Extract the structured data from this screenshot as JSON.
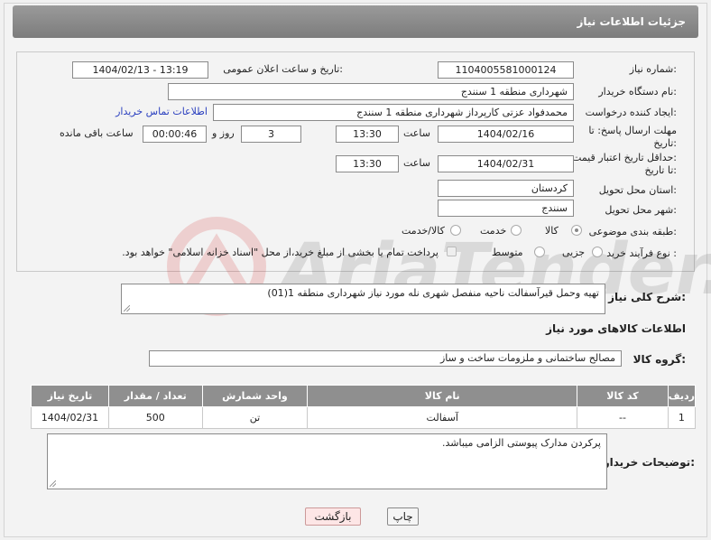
{
  "page": {
    "title": "جزئیات اطلاعات نیاز"
  },
  "form": {
    "need_number": {
      "label": "شماره نیاز:",
      "value": "1104005581000124"
    },
    "announce": {
      "label": "تاریخ و ساعت اعلان عمومی:",
      "value": "1404/02/13 - 13:19"
    },
    "buyer_org": {
      "label": "نام دستگاه خریدار:",
      "value": "شهرداری منطقه 1 سنندج"
    },
    "requester": {
      "label": "ایجاد کننده درخواست:",
      "value": "محمدفواد عزتی کارپرداز شهرداری منطقه 1 سنندج",
      "contact_link": "اطلاعات تماس خریدار"
    },
    "reply_deadline": {
      "label_line1": "مهلت ارسال پاسخ: تا",
      "label_line2": "تاریخ:",
      "date": "1404/02/16",
      "time_label": "ساعت",
      "time": "13:30",
      "days": "3",
      "days_label": "روز و",
      "remaining": "00:00:46",
      "remaining_label": "ساعت باقی مانده"
    },
    "price_validity": {
      "label_line1": "حداقل تاریخ اعتبار قیمت:",
      "label_line2": "تا تاریخ:",
      "date": "1404/02/31",
      "time_label": "ساعت",
      "time": "13:30"
    },
    "province": {
      "label": "استان محل تحویل:",
      "value": "کردستان"
    },
    "city": {
      "label": "شهر محل تحویل:",
      "value": "سنندج"
    },
    "category": {
      "label": "طبقه بندی موضوعی:",
      "options": [
        "کالا",
        "خدمت",
        "کالا/خدمت"
      ],
      "selected": "کالا"
    },
    "process": {
      "label": "نوع فرآیند خرید :",
      "options": [
        "جزیی",
        "متوسط"
      ],
      "selected": "",
      "payment_note": "پرداخت تمام یا بخشی از مبلغ خرید،از محل \"اسناد خزانه اسلامی\" خواهد بود."
    }
  },
  "description": {
    "label": "شرح کلی نیاز:",
    "value": "تهیه وحمل قیرآسفالت ناحیه منفصل شهری نله مورد نیاز شهرداری منطقه 1(01)"
  },
  "goods": {
    "section_title": "اطلاعات کالاهای مورد نیاز",
    "group_label": "گروه کالا:",
    "group_value": "مصالح ساختمانی و ملزومات ساخت و ساز",
    "columns": [
      "ردیف",
      "کد کالا",
      "نام کالا",
      "واحد شمارش",
      "تعداد / مقدار",
      "تاریخ نیاز"
    ],
    "rows": [
      [
        "1",
        "--",
        "آسفالت",
        "تن",
        "500",
        "1404/02/31"
      ]
    ]
  },
  "buyer_notes": {
    "label": "توضیحات خریدار:",
    "value": "پرکردن مدارک پیوستی الزامی میباشد."
  },
  "buttons": {
    "print": "چاپ",
    "back": "بازگشت"
  },
  "colors": {
    "header": "#8f8f8f",
    "link": "#2a3fbf",
    "back_button": "#fde6e6"
  }
}
